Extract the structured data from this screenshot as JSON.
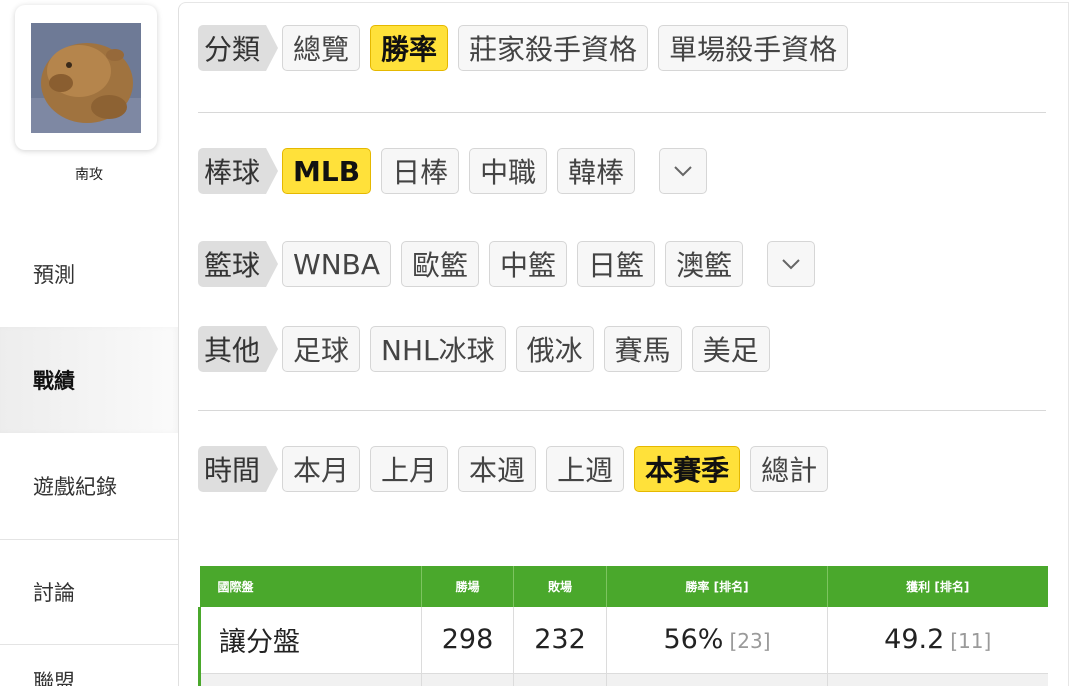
{
  "sidebar": {
    "username": "南攻",
    "items": [
      {
        "label": "預測"
      },
      {
        "label": "戰績"
      },
      {
        "label": "遊戲紀錄"
      },
      {
        "label": "討論"
      },
      {
        "label": "聯盟"
      }
    ]
  },
  "filters": {
    "category": {
      "label": "分類",
      "options": [
        "總覽",
        "勝率",
        "莊家殺手資格",
        "單場殺手資格"
      ],
      "selected": "勝率"
    },
    "baseball": {
      "label": "棒球",
      "options": [
        "MLB",
        "日棒",
        "中職",
        "韓棒"
      ],
      "selected": "MLB"
    },
    "basketball": {
      "label": "籃球",
      "options": [
        "WNBA",
        "歐籃",
        "中籃",
        "日籃",
        "澳籃"
      ]
    },
    "other": {
      "label": "其他",
      "options": [
        "足球",
        "NHL冰球",
        "俄冰",
        "賽馬",
        "美足"
      ]
    },
    "time": {
      "label": "時間",
      "options": [
        "本月",
        "上月",
        "本週",
        "上週",
        "本賽季",
        "總計"
      ],
      "selected": "本賽季"
    }
  },
  "table": {
    "headers": [
      "國際盤",
      "勝場",
      "敗場",
      "勝率 [排名]",
      "獲利 [排名]"
    ],
    "rows": [
      {
        "type": "讓分盤",
        "wins": "298",
        "losses": "232",
        "win_rate": "56%",
        "win_rate_rank": "[23]",
        "profit": "49.2",
        "profit_rank": "[11]"
      }
    ]
  },
  "colors": {
    "accent": "#ffe13a",
    "table_header": "#4aa82c"
  }
}
